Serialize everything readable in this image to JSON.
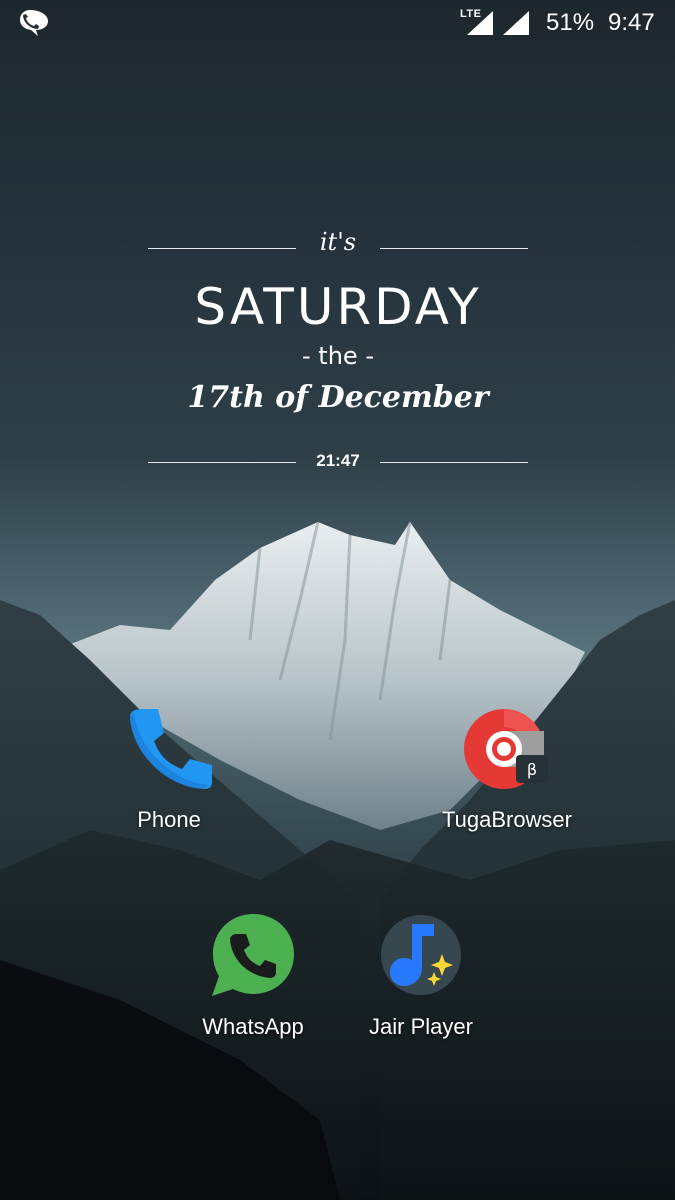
{
  "status_bar": {
    "left_icon": "notification-speech-bubble-icon",
    "network_label": "LTE",
    "battery": "51%",
    "time": "9:47"
  },
  "widget": {
    "its": "it's",
    "day": "SATURDAY",
    "the": "- the -",
    "date": "17th of December",
    "time": "21:47"
  },
  "apps": [
    {
      "label": "Phone",
      "icon": "phone-icon",
      "color": "#2196F3"
    },
    {
      "label": "TugaBrowser",
      "icon": "tugabrowser-icon",
      "color": "#E53935",
      "badge": "β"
    },
    {
      "label": "WhatsApp",
      "icon": "whatsapp-icon",
      "color": "#4CAF50"
    },
    {
      "label": "Jair Player",
      "icon": "jair-player-icon",
      "color": "#2979FF"
    }
  ]
}
